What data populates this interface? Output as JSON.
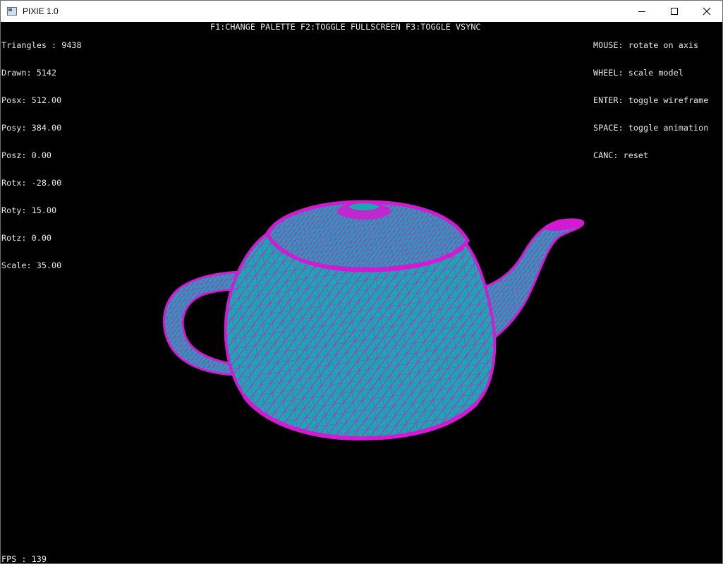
{
  "window": {
    "title": "PIXIE 1.0",
    "app_icon": "window-app-icon",
    "controls": [
      "minimize-icon",
      "maximize-icon",
      "close-icon"
    ]
  },
  "hud": {
    "stats": [
      "Triangles : 9438",
      "Drawn: 5142",
      "Posx: 512.00",
      "Posy: 384.00",
      "Posz: 0.00",
      "Rotx: -28.00",
      "Roty: 15.00",
      "Rotz: 0.00",
      "Scale: 35.00"
    ],
    "keys": "F1:CHANGE PALETTE F2:TOGGLE FULLSCREEN F3:TOGGLE VSYNC",
    "help": [
      "MOUSE: rotate on axis",
      "WHEEL: scale model",
      "ENTER: toggle wireframe",
      "SPACE: toggle animation",
      "CANC: reset"
    ],
    "fps": "FPS : 139"
  },
  "colors": {
    "background": "#000000",
    "fill": "#17a8b0",
    "wire": "#d21ad2",
    "text": "#e8e8e8"
  }
}
